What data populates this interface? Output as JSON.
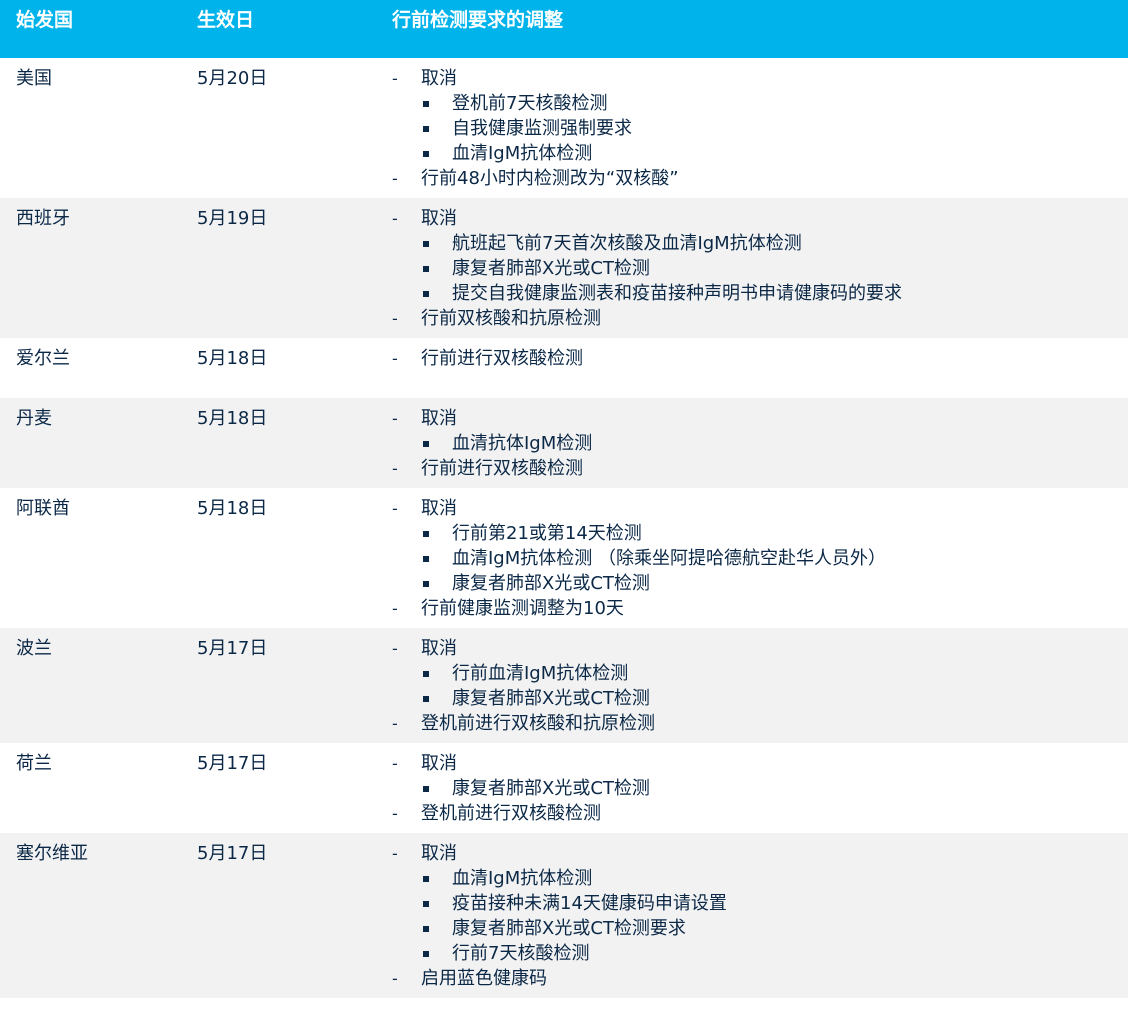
{
  "header": {
    "country": "始发国",
    "date": "生效日",
    "changes": "行前检测要求的调整"
  },
  "rows": [
    {
      "country": "美国",
      "date": "5月20日",
      "lines": [
        {
          "kind": "dash",
          "text": "取消"
        },
        {
          "kind": "sq",
          "text": "登机前7天核酸检测"
        },
        {
          "kind": "sq",
          "text": "自我健康监测强制要求"
        },
        {
          "kind": "sq",
          "text": "血清IgM抗体检测"
        },
        {
          "kind": "dash",
          "text": "行前48小时内检测改为“双核酸”"
        }
      ]
    },
    {
      "country": "西班牙",
      "date": "5月19日",
      "lines": [
        {
          "kind": "dash",
          "text": "取消"
        },
        {
          "kind": "sq",
          "text": "航班起飞前7天首次核酸及血清IgM抗体检测"
        },
        {
          "kind": "sq",
          "text": "康复者肺部X光或CT检测"
        },
        {
          "kind": "sq",
          "text": "提交自我健康监测表和疫苗接种声明书申请健康码的要求"
        },
        {
          "kind": "dash",
          "text": "行前双核酸和抗原检测"
        }
      ]
    },
    {
      "country": "爱尔兰",
      "date": "5月18日",
      "lines": [
        {
          "kind": "dash",
          "text": "行前进行双核酸检测"
        }
      ]
    },
    {
      "country": "丹麦",
      "date": "5月18日",
      "lines": [
        {
          "kind": "dash",
          "text": "取消"
        },
        {
          "kind": "sq",
          "text": "血清抗体IgM检测"
        },
        {
          "kind": "dash",
          "text": "行前进行双核酸检测"
        }
      ]
    },
    {
      "country": "阿联酋",
      "date": "5月18日",
      "lines": [
        {
          "kind": "dash",
          "text": "取消"
        },
        {
          "kind": "sq",
          "text": "行前第21或第14天检测"
        },
        {
          "kind": "sq",
          "text": "血清IgM抗体检测 （除乘坐阿提哈德航空赴华人员外）"
        },
        {
          "kind": "sq",
          "text": "康复者肺部X光或CT检测"
        },
        {
          "kind": "dash",
          "text": "行前健康监测调整为10天"
        }
      ]
    },
    {
      "country": "波兰",
      "date": "5月17日",
      "lines": [
        {
          "kind": "dash",
          "text": "取消"
        },
        {
          "kind": "sq",
          "text": "行前血清IgM抗体检测"
        },
        {
          "kind": "sq",
          "text": "康复者肺部X光或CT检测"
        },
        {
          "kind": "dash",
          "text": "登机前进行双核酸和抗原检测"
        }
      ]
    },
    {
      "country": "荷兰",
      "date": "5月17日",
      "lines": [
        {
          "kind": "dash",
          "text": "取消"
        },
        {
          "kind": "sq",
          "text": "康复者肺部X光或CT检测"
        },
        {
          "kind": "dash",
          "text": "登机前进行双核酸检测"
        }
      ]
    },
    {
      "country": "塞尔维亚",
      "date": "5月17日",
      "lines": [
        {
          "kind": "dash",
          "text": "取消"
        },
        {
          "kind": "sq",
          "text": "血清IgM抗体检测"
        },
        {
          "kind": "sq",
          "text": "疫苗接种未满14天健康码申请设置"
        },
        {
          "kind": "sq",
          "text": "康复者肺部X光或CT检测要求"
        },
        {
          "kind": "sq",
          "text": "行前7天核酸检测"
        },
        {
          "kind": "dash",
          "text": "启用蓝色健康码"
        }
      ]
    }
  ]
}
